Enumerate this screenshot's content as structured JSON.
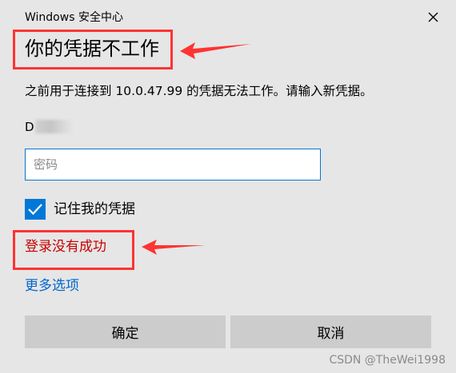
{
  "window": {
    "title": "Windows 安全中心",
    "close_icon": "close-icon"
  },
  "heading": "你的凭据不工作",
  "description": "之前用于连接到 10.0.47.99 的凭据无法工作。请输入新凭据。",
  "username_visible": "D",
  "password": {
    "value": "",
    "placeholder": "密码"
  },
  "remember": {
    "label": "记住我的凭据",
    "checked": true
  },
  "error": "登录没有成功",
  "more_options": "更多选项",
  "buttons": {
    "ok": "确定",
    "cancel": "取消"
  },
  "watermark": "CSDN @TheWei1998",
  "colors": {
    "accent": "#0078d7",
    "error": "#c80000",
    "link": "#0066cc",
    "annotation": "#ff3333"
  }
}
